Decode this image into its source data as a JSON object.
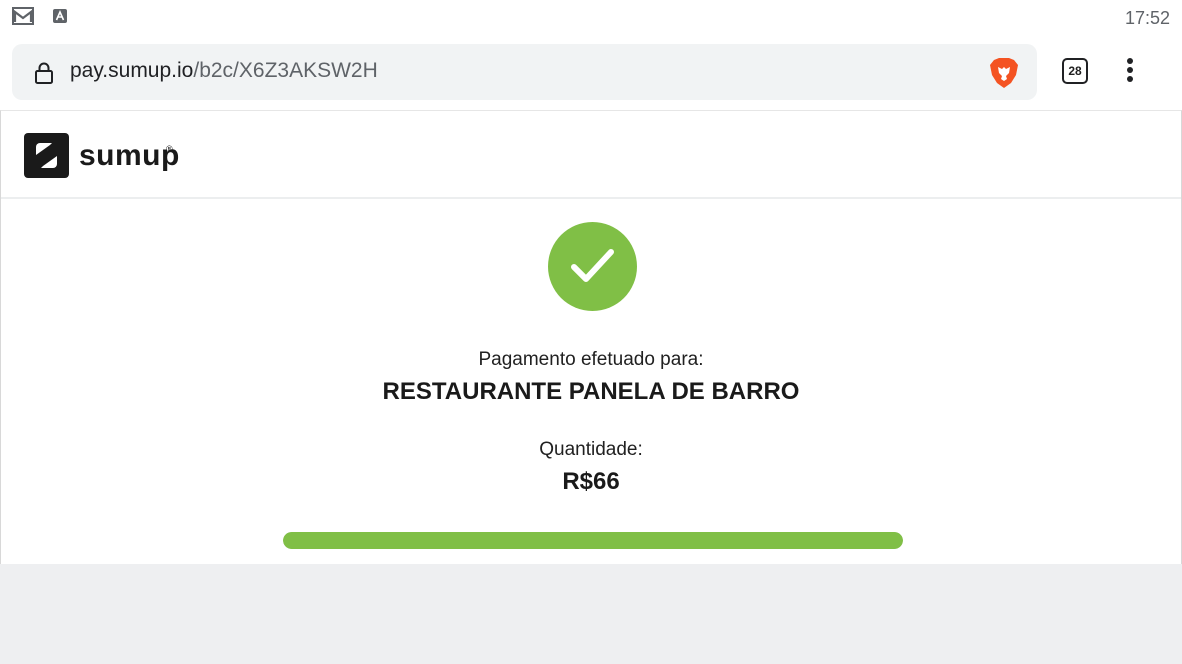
{
  "status_bar": {
    "icons": [
      "gmail-icon",
      "app-a-icon"
    ],
    "time": "17:52"
  },
  "browser": {
    "url_host": "pay.sumup.io",
    "url_path": "/b2c/X6Z3AKSW2H",
    "tab_count": "28",
    "icons": [
      "lock-icon",
      "brave-lion-icon",
      "more-vert-icon"
    ]
  },
  "site": {
    "logo_text": "sumup",
    "logo_registered": "®"
  },
  "payment": {
    "paid_to_label": "Pagamento efetuado para:",
    "merchant": "RESTAURANTE PANELA DE BARRO",
    "amount_label": "Quantidade:",
    "amount": "R$66",
    "progress_percent": 100
  },
  "colors": {
    "success_green": "#80bf46",
    "brand_dark": "#1a1a1a"
  }
}
